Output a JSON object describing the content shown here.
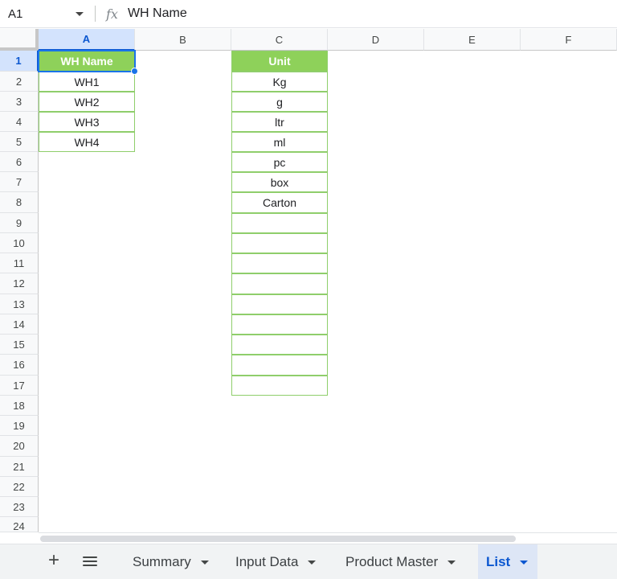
{
  "formula_bar": {
    "name_box": "A1",
    "fx_label": "fx",
    "content": "WH Name"
  },
  "columns": [
    "A",
    "B",
    "C",
    "D",
    "E",
    "F"
  ],
  "rows": [
    "1",
    "2",
    "3",
    "4",
    "5",
    "6",
    "7",
    "8",
    "9",
    "10",
    "11",
    "12",
    "13",
    "14",
    "15",
    "16",
    "17",
    "18",
    "19",
    "20",
    "21",
    "22",
    "23",
    "24"
  ],
  "cells": {
    "A1": "WH Name",
    "A2": "WH1",
    "A3": "WH2",
    "A4": "WH3",
    "A5": "WH4",
    "C1": "Unit",
    "C2": "Kg",
    "C3": "g",
    "C4": "ltr",
    "C5": "ml",
    "C6": "pc",
    "C7": "box",
    "C8": "Carton"
  },
  "tabs": {
    "add_icon": "+",
    "items": [
      {
        "label": "Summary",
        "active": false
      },
      {
        "label": "Input Data",
        "active": false
      },
      {
        "label": "Product Master",
        "active": false
      },
      {
        "label": "List",
        "active": true
      }
    ]
  },
  "colors": {
    "header_fill": "#8ed15a",
    "table_border": "#8fce6b",
    "selection": "#1a73e8"
  }
}
